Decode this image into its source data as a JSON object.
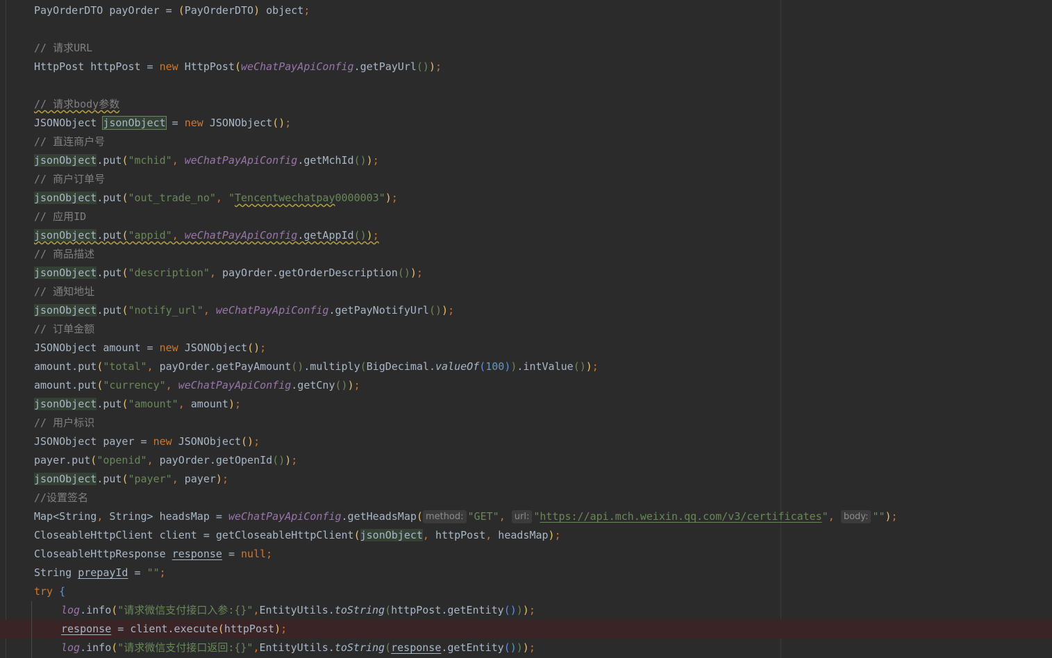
{
  "editor": {
    "language": "Java",
    "colors": {
      "background": "#2b2b2b",
      "keyword": "#cc7832",
      "string": "#6a8759",
      "comment": "#808080",
      "field": "#9876aa",
      "number": "#6897bb",
      "identifier": "#a9b7c6",
      "highlight": "#344134",
      "error_line": "#3b2426"
    },
    "lines": [
      "PayOrderDTO payOrder = (PayOrderDTO) object;",
      "",
      "// 请求URL",
      "HttpPost httpPost = new HttpPost(weChatPayApiConfig.getPayUrl());",
      "",
      "// 请求body参数",
      "JSONObject jsonObject = new JSONObject();",
      "// 直连商户号",
      "jsonObject.put(\"mchid\", weChatPayApiConfig.getMchId());",
      "// 商户订单号",
      "jsonObject.put(\"out_trade_no\", \"Tencentwechatpay0000003\");",
      "// 应用ID",
      "jsonObject.put(\"appid\", weChatPayApiConfig.getAppId());",
      "// 商品描述",
      "jsonObject.put(\"description\", payOrder.getOrderDescription());",
      "// 通知地址",
      "jsonObject.put(\"notify_url\", weChatPayApiConfig.getPayNotifyUrl());",
      "// 订单金额",
      "JSONObject amount = new JSONObject();",
      "amount.put(\"total\", payOrder.getPayAmount().multiply(BigDecimal.valueOf(100)).intValue());",
      "amount.put(\"currency\", weChatPayApiConfig.getCny());",
      "jsonObject.put(\"amount\", amount);",
      "// 用户标识",
      "JSONObject payer = new JSONObject();",
      "payer.put(\"openid\", payOrder.getOpenId());",
      "jsonObject.put(\"payer\", payer);",
      "//设置签名",
      "Map<String, String> headsMap = weChatPayApiConfig.getHeadsMap(method: \"GET\", url: \"https://api.mch.weixin.qq.com/v3/certificates\", body: \"\");",
      "CloseableHttpClient client = getCloseableHttpClient(jsonObject, httpPost, headsMap);",
      "CloseableHttpResponse response = null;",
      "String prepayId = \"\";",
      "try {",
      "    log.info(\"请求微信支付接口入参:{}\",EntityUtils.toString(httpPost.getEntity()));",
      "    response = client.execute(httpPost);",
      "    log.info(\"请求微信支付接口返回:{}\",EntityUtils.toString(response.getEntity()));"
    ],
    "tokens": {
      "c1": "// 请求URL",
      "c2": "// 请求body参数",
      "c3": "// 直连商户号",
      "c4": "// 商户订单号",
      "c5": "// 应用ID",
      "c6": "// 商品描述",
      "c7": "// 通知地址",
      "c8": "// 订单金额",
      "c9": "// 用户标识",
      "c10": "//设置签名",
      "s_mchid": "\"mchid\"",
      "s_out_trade_no": "\"out_trade_no\"",
      "s_tencent_open": "\"",
      "s_tencent": "Tencentwechatpay",
      "s_tencent_tail": "0000003\"",
      "s_appid": "\"appid\"",
      "s_description": "\"description\"",
      "s_notify_url": "\"notify_url\"",
      "s_total": "\"total\"",
      "s_currency": "\"currency\"",
      "s_amount": "\"amount\"",
      "s_openid": "\"openid\"",
      "s_payer": "\"payer\"",
      "s_get": "\"GET\"",
      "s_url_q": "\"",
      "s_url": "https://api.mch.weixin.qq.com/v3/certificates",
      "s_empty": "\"\"",
      "s_log_in": "\"请求微信支付接口入参:{}\"",
      "s_log_out": "\"请求微信支付接口返回:{}\"",
      "hint_method": "method:",
      "hint_url": "url:",
      "hint_body": "body:",
      "n_100": "100",
      "kw_new": "new",
      "kw_try": "try",
      "kw_null": "null",
      "f_config": "weChatPayApiConfig",
      "f_log": "log",
      "m_valueOf": "valueOf",
      "m_toString": "toString",
      "v_jsonObject": "jsonObject",
      "v_response": "response",
      "v_prepayId": "prepayId"
    }
  }
}
